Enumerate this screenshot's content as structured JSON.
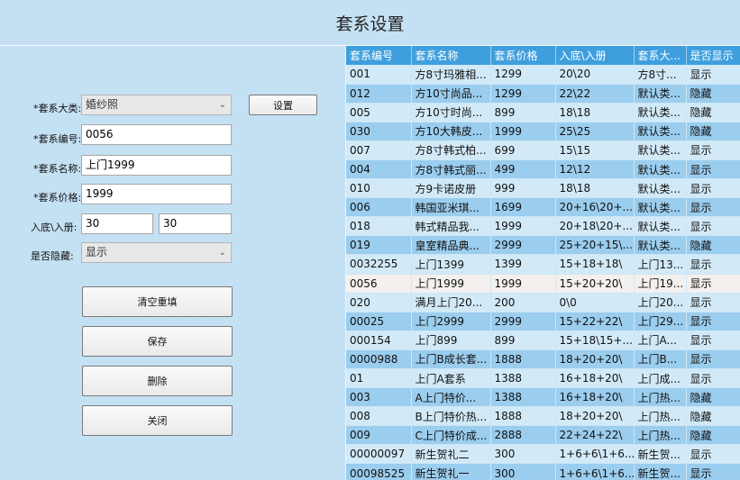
{
  "window": {
    "title": "套系设置"
  },
  "form": {
    "category": {
      "label": "*套系大类:",
      "value": "婚纱照"
    },
    "set_button": "设置",
    "code": {
      "label": "*套系编号:",
      "value": "0056"
    },
    "name": {
      "label": "*套系名称:",
      "value": "上门1999"
    },
    "price": {
      "label": "*套系价格:",
      "value": "1999"
    },
    "entry": {
      "label": "入底\\入册:",
      "value1": "30",
      "value2": "30"
    },
    "hidden": {
      "label": "是否隐藏:",
      "value": "显示"
    },
    "buttons": {
      "clear": "清空重填",
      "save": "保存",
      "delete": "删除",
      "close": "关闭"
    }
  },
  "table": {
    "columns": [
      "套系编号",
      "套系名称",
      "套系价格",
      "入底\\入册",
      "套系大...",
      "是否显示"
    ],
    "rows": [
      [
        "001",
        "方8寸玛雅相...",
        "1299",
        "20\\20",
        "方8寸...",
        "显示"
      ],
      [
        "012",
        "方10寸尚品...",
        "1299",
        "22\\22",
        "默认类...",
        "隐藏"
      ],
      [
        "005",
        "方10寸时尚...",
        "899",
        "18\\18",
        "默认类...",
        "隐藏"
      ],
      [
        "030",
        "方10大韩皮...",
        "1999",
        "25\\25",
        "默认类...",
        "隐藏"
      ],
      [
        "007",
        "方8寸韩式柏...",
        "699",
        "15\\15",
        "默认类...",
        "显示"
      ],
      [
        "004",
        "方8寸韩式丽...",
        "499",
        "12\\12",
        "默认类...",
        "显示"
      ],
      [
        "010",
        "方9卡诺皮册",
        "999",
        "18\\18",
        "默认类...",
        "显示"
      ],
      [
        "006",
        "韩国亚米琪...",
        "1699",
        "20+16\\20+...",
        "默认类...",
        "显示"
      ],
      [
        "018",
        "韩式精品我...",
        "1999",
        "20+18\\20+...",
        "默认类...",
        "显示"
      ],
      [
        "019",
        "皇室精品典...",
        "2999",
        "25+20+15\\...",
        "默认类...",
        "隐藏"
      ],
      [
        "0032255",
        "上门1399",
        "1399",
        "15+18+18\\",
        "上门13...",
        "显示"
      ],
      [
        "0056",
        "上门1999",
        "1999",
        "15+20+20\\",
        "上门19...",
        "显示"
      ],
      [
        "020",
        "满月上门20...",
        "200",
        "0\\0",
        "上门20...",
        "显示"
      ],
      [
        "00025",
        "上门2999",
        "2999",
        "15+22+22\\",
        "上门29...",
        "显示"
      ],
      [
        "000154",
        "上门899",
        "899",
        "15+18\\15+...",
        "上门A...",
        "显示"
      ],
      [
        "0000988",
        "上门B成长套...",
        "1888",
        "18+20+20\\",
        "上门B...",
        "显示"
      ],
      [
        "01",
        "上门A套系",
        "1388",
        "16+18+20\\",
        "上门成...",
        "显示"
      ],
      [
        "003",
        "A上门特价...",
        "1388",
        "16+18+20\\",
        "上门热...",
        "隐藏"
      ],
      [
        "008",
        "B上门特价热...",
        "1888",
        "18+20+20\\",
        "上门热...",
        "隐藏"
      ],
      [
        "009",
        "C上门特价成...",
        "2888",
        "22+24+22\\",
        "上门热...",
        "隐藏"
      ],
      [
        "00000097",
        "新生贺礼二",
        "300",
        "1+6+6\\1+6...",
        "新生贺...",
        "显示"
      ],
      [
        "00098525",
        "新生贺礼一",
        "300",
        "1+6+6\\1+6...",
        "新生贺...",
        "显示"
      ]
    ],
    "selected_index": 11
  }
}
